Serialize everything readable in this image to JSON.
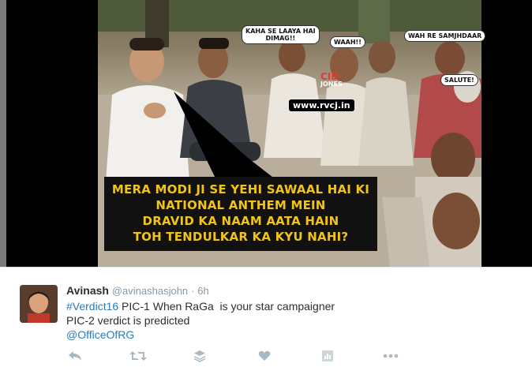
{
  "meme": {
    "bubbles": [
      "KAHA SE LAAYA HAI",
      "DIMAG!!",
      "WAAH!!",
      "WAH RE SAMJHDAAR",
      "SALUTE!"
    ],
    "cid_label_1": "CID",
    "cid_label_2": "JONES",
    "watermark": "www.rvcj.in",
    "caption_lines": [
      "MERA MODI JI SE YEHI SAWAAL HAI KI",
      "NATIONAL ANTHEM MEIN",
      "DRAVID KA NAAM AATA HAIN",
      "TOH TENDULKAR KA KYU NAHI?"
    ]
  },
  "tweet": {
    "author_name": "Avinash",
    "author_handle": "@avinashasjohn",
    "separator": "·",
    "time": "6h",
    "hashtag": "#Verdict16",
    "line1_rest": " PIC-1 When RaGa  is your star campaigner",
    "line2": "PIC-2 verdict is predicted",
    "mention": "@OfficeOfRG"
  },
  "actions": [
    "reply-icon",
    "retweet-icon",
    "buffer-icon",
    "like-icon",
    "analytics-icon",
    "more-icon"
  ],
  "colors": {
    "caption_text": "#f0c419",
    "link": "#2b7bb9",
    "icon": "#aab8c2"
  }
}
